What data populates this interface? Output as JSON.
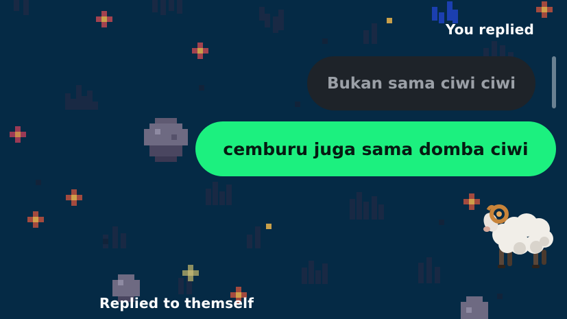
{
  "chat": {
    "you_replied_label": "You replied",
    "quoted_message": "Bukan sama ciwi ciwi",
    "reply_message": "cemburu juga sama domba ciwi",
    "reaction_emoji": "ram-emoji",
    "bottom_label": "Replied to themself"
  },
  "colors": {
    "background": "#052a45",
    "quoted_bubble": "#1e2329",
    "quoted_text": "#9ba0a7",
    "reply_bubble": "#1cf07f",
    "reply_text": "#061a12",
    "label_text": "#ffffff"
  },
  "background_theme": "pixel-art-night-grass-with-flowers-and-rocks"
}
